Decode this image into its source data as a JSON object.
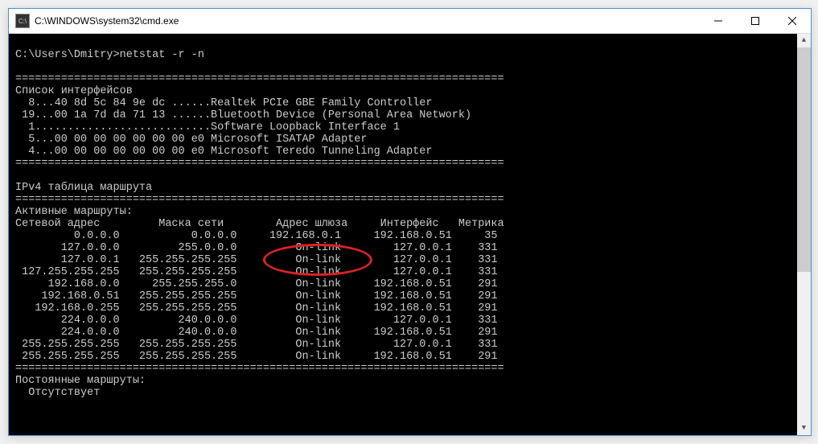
{
  "window": {
    "title": "C:\\WINDOWS\\system32\\cmd.exe"
  },
  "console": {
    "prompt": "C:\\Users\\Dmitry>netstat -r -n",
    "sep": "===========================================================================",
    "interfaces_header": "Список интерфейсов",
    "interfaces": [
      "  8...40 8d 5c 84 9e dc ......Realtek PCIe GBE Family Controller",
      " 19...00 1a 7d da 71 13 ......Bluetooth Device (Personal Area Network)",
      "  1...........................Software Loopback Interface 1",
      "  5...00 00 00 00 00 00 00 e0 Microsoft ISATAP Adapter",
      "  4...00 00 00 00 00 00 00 e0 Microsoft Teredo Tunneling Adapter"
    ],
    "ipv4_title": "IPv4 таблица маршрута",
    "active_routes": "Активные маршруты:",
    "columns": {
      "dest": "Сетевой адрес",
      "mask": "Маска сети",
      "gateway": "Адрес шлюза",
      "iface": "Интерфейс",
      "metric": "Метрика"
    },
    "routes": [
      {
        "dest": "0.0.0.0",
        "mask": "0.0.0.0",
        "gateway": "192.168.0.1",
        "iface": "192.168.0.51",
        "metric": "35"
      },
      {
        "dest": "127.0.0.0",
        "mask": "255.0.0.0",
        "gateway": "On-link",
        "iface": "127.0.0.1",
        "metric": "331"
      },
      {
        "dest": "127.0.0.1",
        "mask": "255.255.255.255",
        "gateway": "On-link",
        "iface": "127.0.0.1",
        "metric": "331"
      },
      {
        "dest": "127.255.255.255",
        "mask": "255.255.255.255",
        "gateway": "On-link",
        "iface": "127.0.0.1",
        "metric": "331"
      },
      {
        "dest": "192.168.0.0",
        "mask": "255.255.255.0",
        "gateway": "On-link",
        "iface": "192.168.0.51",
        "metric": "291"
      },
      {
        "dest": "192.168.0.51",
        "mask": "255.255.255.255",
        "gateway": "On-link",
        "iface": "192.168.0.51",
        "metric": "291"
      },
      {
        "dest": "192.168.0.255",
        "mask": "255.255.255.255",
        "gateway": "On-link",
        "iface": "192.168.0.51",
        "metric": "291"
      },
      {
        "dest": "224.0.0.0",
        "mask": "240.0.0.0",
        "gateway": "On-link",
        "iface": "127.0.0.1",
        "metric": "331"
      },
      {
        "dest": "224.0.0.0",
        "mask": "240.0.0.0",
        "gateway": "On-link",
        "iface": "192.168.0.51",
        "metric": "291"
      },
      {
        "dest": "255.255.255.255",
        "mask": "255.255.255.255",
        "gateway": "On-link",
        "iface": "127.0.0.1",
        "metric": "331"
      },
      {
        "dest": "255.255.255.255",
        "mask": "255.255.255.255",
        "gateway": "On-link",
        "iface": "192.168.0.51",
        "metric": "291"
      }
    ],
    "persistent_routes": "Постоянные маршруты:",
    "persistent_none": "  Отсутствует"
  }
}
